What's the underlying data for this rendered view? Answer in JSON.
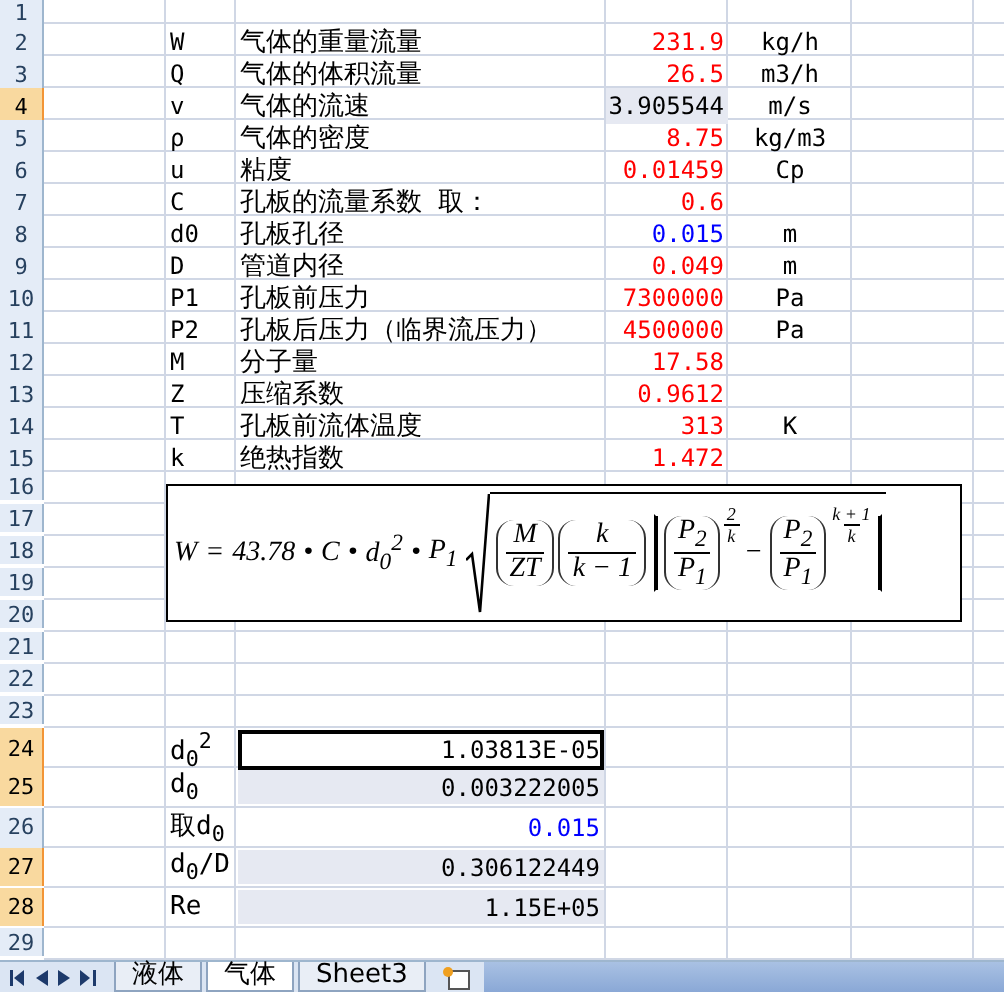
{
  "rows": [
    {
      "number": "1",
      "kind": "empty",
      "selected": false,
      "active": false
    },
    {
      "number": "2",
      "kind": "param",
      "symbol": "W",
      "label": "气体的重量流量",
      "value": "231.9",
      "color": "#ff0000",
      "unit": "kg/h",
      "selected": false,
      "active": false
    },
    {
      "number": "3",
      "kind": "param",
      "symbol": "Q",
      "label": "气体的体积流量",
      "value": "26.5",
      "color": "#ff0000",
      "unit": "m3/h",
      "selected": false,
      "active": false
    },
    {
      "number": "4",
      "kind": "param",
      "symbol": "v",
      "label": "气体的流速",
      "value": "3.905544",
      "color": "#000000",
      "unit": "m/s",
      "selected": true,
      "active": false
    },
    {
      "number": "5",
      "kind": "param",
      "symbol": "ρ",
      "label": "气体的密度",
      "value": "8.75",
      "color": "#ff0000",
      "unit": "kg/m3",
      "selected": false,
      "active": false
    },
    {
      "number": "6",
      "kind": "param",
      "symbol": "u",
      "label": "粘度",
      "value": "0.01459",
      "color": "#ff0000",
      "unit": "Cp",
      "selected": false,
      "active": false
    },
    {
      "number": "7",
      "kind": "param",
      "symbol": "C",
      "label": "孔板的流量系数 取：",
      "value": "0.6",
      "color": "#ff0000",
      "selected": false,
      "active": false
    },
    {
      "number": "8",
      "kind": "param",
      "symbol": "d0",
      "label": "孔板孔径",
      "value": "0.015",
      "color": "#0000ff",
      "unit": "m",
      "selected": false,
      "active": false
    },
    {
      "number": "9",
      "kind": "param",
      "symbol": "D",
      "label": "管道内径",
      "value": "0.049",
      "color": "#ff0000",
      "unit": "m",
      "selected": false,
      "active": false
    },
    {
      "number": "10",
      "kind": "param",
      "symbol": "P1",
      "label": "孔板前压力",
      "value": "7300000",
      "color": "#ff0000",
      "unit": "Pa",
      "selected": false,
      "active": false
    },
    {
      "number": "11",
      "kind": "param",
      "symbol": "P2",
      "label": "孔板后压力（临界流压力）",
      "value": "4500000",
      "color": "#ff0000",
      "unit": "Pa",
      "selected": false,
      "active": false
    },
    {
      "number": "12",
      "kind": "param",
      "symbol": "M",
      "label": "分子量",
      "value": "17.58",
      "color": "#ff0000",
      "selected": false,
      "active": false
    },
    {
      "number": "13",
      "kind": "param",
      "symbol": "Z",
      "label": "压缩系数",
      "value": "0.9612",
      "color": "#ff0000",
      "selected": false,
      "active": false
    },
    {
      "number": "14",
      "kind": "param",
      "symbol": "T",
      "label": "孔板前流体温度",
      "value": "313",
      "color": "#ff0000",
      "unit": "K",
      "selected": false,
      "active": false
    },
    {
      "number": "15",
      "kind": "param",
      "symbol": "k",
      "label": "绝热指数",
      "value": "1.472",
      "color": "#ff0000",
      "selected": false,
      "active": false
    },
    {
      "number": "16",
      "kind": "empty",
      "selected": false,
      "active": false
    },
    {
      "number": "17",
      "kind": "empty",
      "selected": false,
      "active": false
    },
    {
      "number": "18",
      "kind": "empty",
      "selected": false,
      "active": false
    },
    {
      "number": "19",
      "kind": "empty",
      "selected": false,
      "active": false
    },
    {
      "number": "20",
      "kind": "empty",
      "selected": false,
      "active": false
    },
    {
      "number": "21",
      "kind": "empty",
      "selected": false,
      "active": false
    },
    {
      "number": "22",
      "kind": "empty",
      "selected": false,
      "active": false
    },
    {
      "number": "23",
      "kind": "empty",
      "selected": false,
      "active": false
    },
    {
      "number": "24",
      "kind": "result",
      "label": "d$_{0}$$^{2}$",
      "value": "1.03813E-05",
      "color": "#000000",
      "selected": true,
      "active": true
    },
    {
      "number": "25",
      "kind": "result",
      "label": "d$_{0}$",
      "value": "0.003222005",
      "color": "#000000",
      "selected": true,
      "active": false
    },
    {
      "number": "26",
      "kind": "result",
      "label": "取d$_{0}$",
      "value": "0.015",
      "color": "#0000ff",
      "selected": false,
      "active": false
    },
    {
      "number": "27",
      "kind": "result",
      "label": "d$_{0}$/D",
      "value": "0.306122449",
      "color": "#000000",
      "selected": true,
      "active": false
    },
    {
      "number": "28",
      "kind": "result",
      "label": "Re",
      "value": "1.15E+05",
      "color": "#000000",
      "selected": true,
      "active": false
    },
    {
      "number": "29",
      "kind": "empty",
      "selected": false,
      "active": false
    }
  ],
  "formula": {
    "terms": [
      "W",
      "=",
      "43.78",
      "•",
      "C",
      "•",
      "d$_{0}$$^{2}$",
      "•",
      "P$_{1}$"
    ],
    "fractions": [
      {
        "numerator": "M",
        "denominator": "ZT"
      },
      {
        "numerator": "k",
        "denominator": "k − 1"
      }
    ],
    "powers": [
      {
        "numerator": "P$_{2}$",
        "denominator": "P$_{1}$",
        "exponent_numerator": "2",
        "exponent_denominator": "k"
      },
      {
        "numerator": "P$_{2}$",
        "denominator": "P$_{1}$",
        "exponent_numerator": "k + 1",
        "exponent_denominator": "k"
      }
    ],
    "operator": "−"
  },
  "sheet_tabs": [
    {
      "label": "液体",
      "selected": false
    },
    {
      "label": "气体",
      "selected": true
    },
    {
      "label": "Sheet3",
      "selected": false
    }
  ]
}
